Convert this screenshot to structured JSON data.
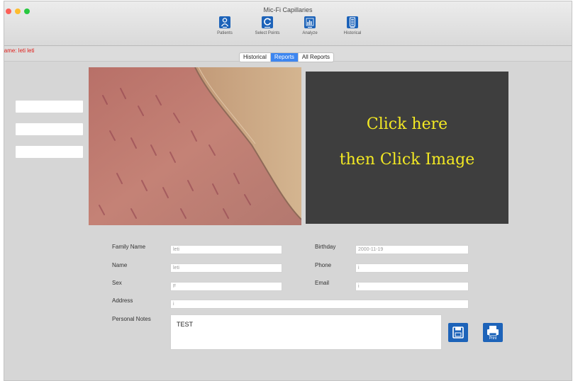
{
  "window": {
    "title": "Mic-Fi Capillaries"
  },
  "toolbar": {
    "items": [
      {
        "label": "Patients",
        "icon": "person-icon"
      },
      {
        "label": "Select Points",
        "icon": "refresh-icon"
      },
      {
        "label": "Analyze",
        "icon": "bar-chart-icon"
      },
      {
        "label": "Historical",
        "icon": "list-icon"
      }
    ]
  },
  "patient_name_label": "Name: leti leti",
  "tabs": [
    {
      "label": "Historical",
      "active": false
    },
    {
      "label": "Reports",
      "active": true
    },
    {
      "label": "All Reports",
      "active": false
    }
  ],
  "image_panel": {
    "line1": "Click here",
    "line2": "then Click Image"
  },
  "form": {
    "family_name": {
      "label": "Family Name",
      "value": "leti"
    },
    "name": {
      "label": "Name",
      "value": "leti"
    },
    "sex": {
      "label": "Sex",
      "value": "F"
    },
    "address": {
      "label": "Address",
      "value": "i"
    },
    "birthday": {
      "label": "Birthday",
      "value": "2000-11-19"
    },
    "phone": {
      "label": "Phone",
      "value": "i"
    },
    "email": {
      "label": "Email",
      "value": "i"
    },
    "personal_notes": {
      "label": "Personal Notes",
      "value": "TEST"
    }
  },
  "actions": {
    "save": {
      "icon": "floppy-disk-icon"
    },
    "print": {
      "label": "Print",
      "icon": "printer-icon"
    }
  },
  "colors": {
    "accent": "#1d63b9",
    "active_tab": "#3d86f0",
    "name_label": "#e0201c",
    "overlay_text": "#f3e923",
    "overlay_bg": "#3e3e3e"
  }
}
